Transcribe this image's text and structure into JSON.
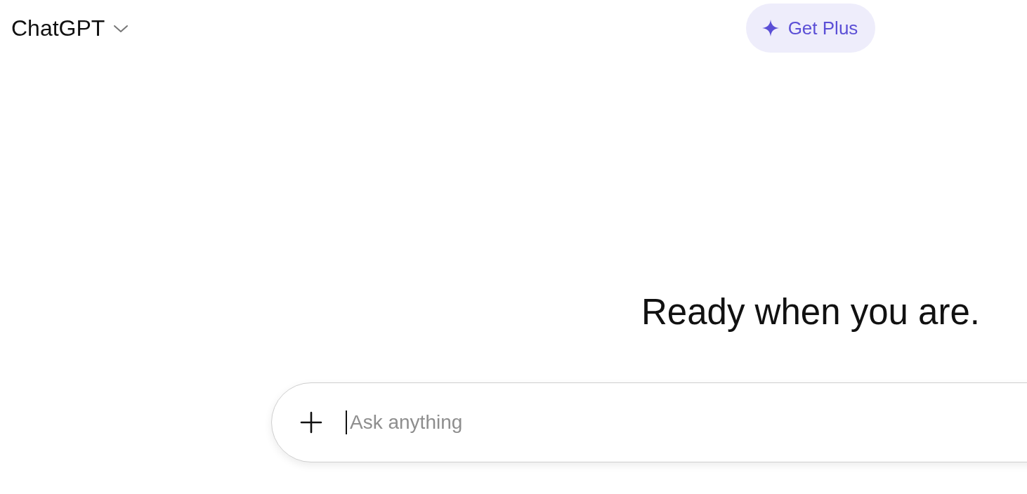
{
  "header": {
    "title": "ChatGPT",
    "upgrade_button": "Get Plus"
  },
  "heading": "Ready when you are.",
  "composer": {
    "placeholder": "Ask anything",
    "focused": true
  }
}
